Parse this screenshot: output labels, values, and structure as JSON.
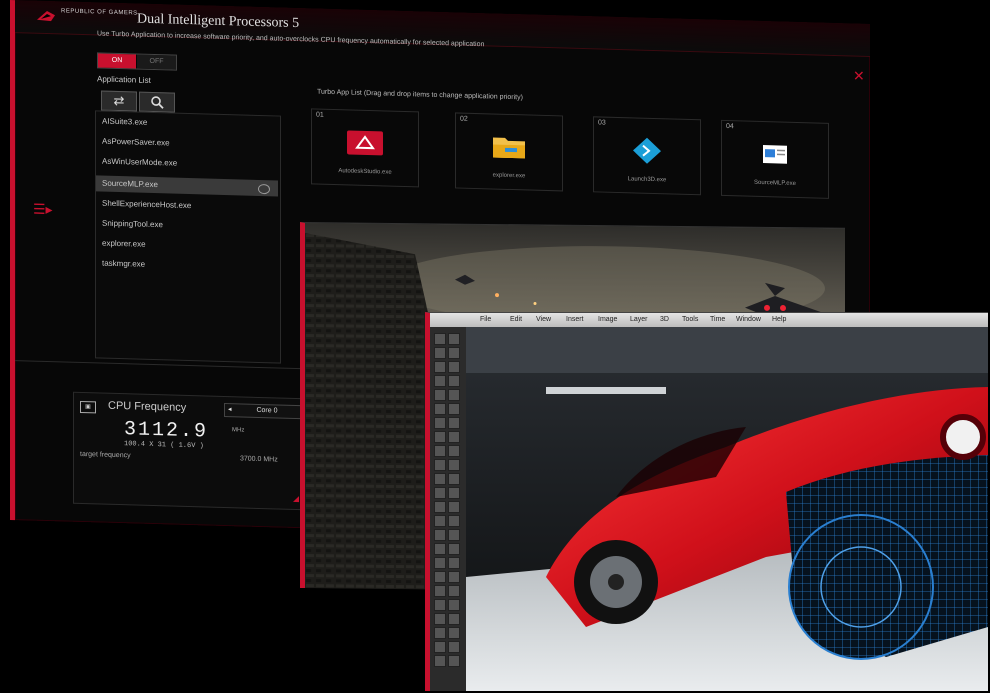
{
  "app": {
    "brand": "REPUBLIC OF GAMERS",
    "title": "Dual Intelligent Processors 5",
    "description": "Use Turbo Application to increase software priority, and auto-overclocks CPU frequency automatically for selected application",
    "toggle_on": "ON",
    "toggle_off": "OFF",
    "application_list_label": "Application List",
    "application_list": [
      "AISuite3.exe",
      "AsPowerSaver.exe",
      "AsWinUserMode.exe",
      "SourceMLP.exe",
      "ShellExperienceHost.exe",
      "SnippingTool.exe",
      "explorer.exe",
      "taskmgr.exe"
    ],
    "selected_index": 3,
    "turbo_label": "Turbo App List (Drag and drop items to change application priority)",
    "turbo_apps": [
      {
        "num": "01",
        "name": "AutodeskStudio.exe",
        "icon": "autodesk-app-icon"
      },
      {
        "num": "02",
        "name": "explorer.exe",
        "icon": "folder-icon"
      },
      {
        "num": "03",
        "name": "Launch3D.exe",
        "icon": "diamond-app-icon"
      },
      {
        "num": "04",
        "name": "SourceMLP.exe",
        "icon": "window-app-icon"
      }
    ],
    "cpu": {
      "label": "CPU Frequency",
      "core": "Core 0",
      "frequency": "3112.9",
      "unit": "MHz",
      "ratio": "100.4 X 31 ( 1.6",
      "volt": "V ) ",
      "target_label": "target frequency",
      "target_value": "3700.0 MHz"
    }
  },
  "design": {
    "menus": [
      "File",
      "Edit",
      "View",
      "Insert",
      "Image",
      "Layer",
      "3D",
      "Tools",
      "Time",
      "Window",
      "Help"
    ]
  },
  "colors": {
    "accent": "#c8102e",
    "background": "#000000",
    "car_red": "#d0101a",
    "wire_blue": "#2a7fd0"
  }
}
